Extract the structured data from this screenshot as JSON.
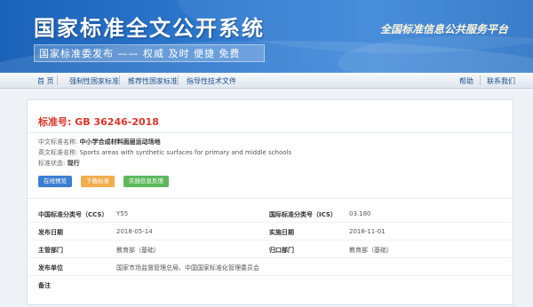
{
  "header": {
    "site_title": "国家标准全文公开系统",
    "slogan": "国家标准委发布 —— 权威 及时 便捷 免费",
    "platform_name": "全国标准信息公共服务平台"
  },
  "nav": {
    "items": [
      "首 页",
      "强制性国家标准",
      "推荐性国家标准",
      "指导性技术文件"
    ],
    "right_items": [
      "帮助",
      "联系我们"
    ]
  },
  "standard": {
    "code_label": "标准号:",
    "code": "GB 36246-2018",
    "cn_name_label": "中文标准名称:",
    "cn_name": "中小学合成材料面层运动场地",
    "en_name_label": "英文标准名称:",
    "en_name": "Sports areas with synthetic surfaces for primary and middle schools",
    "status_label": "标准状态:",
    "status": "现行"
  },
  "actions": {
    "preview": "在线预览",
    "download": "下载标准",
    "feedback": "实施信息反馈"
  },
  "details": {
    "rows": [
      {
        "k1": "中国标准分类号（CCS）",
        "v1": "Y55",
        "k2": "国际标准分类号（ICS）",
        "v2": "03.180"
      },
      {
        "k1": "发布日期",
        "v1": "2018-05-14",
        "k2": "实施日期",
        "v2": "2018-11-01"
      },
      {
        "k1": "主管部门",
        "v1": "教育部（基础）",
        "k2": "归口部门",
        "v2": "教育部（基础）"
      },
      {
        "k1": "发布单位",
        "v1": "国家市场监督管理总局、中国国家标准化管理委员会",
        "k2": "",
        "v2": ""
      },
      {
        "k1": "备注",
        "v1": "",
        "k2": "",
        "v2": ""
      }
    ]
  }
}
